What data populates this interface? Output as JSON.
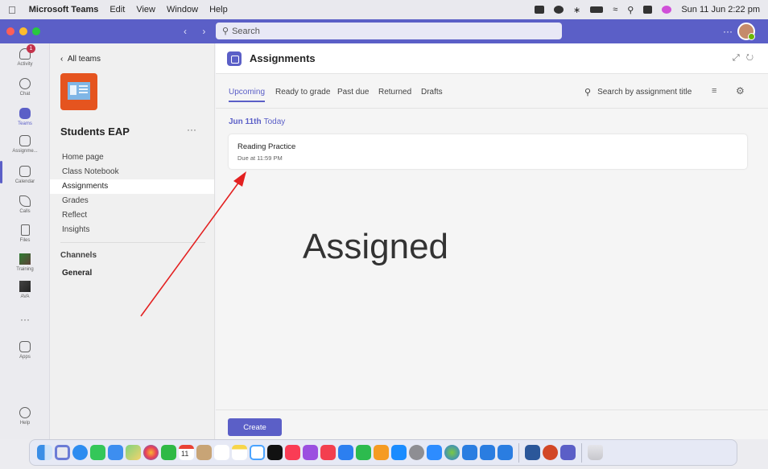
{
  "menubar": {
    "app_name": "Microsoft Teams",
    "items": [
      "Edit",
      "View",
      "Window",
      "Help"
    ],
    "datetime": "Sun 11 Jun  2:22 pm"
  },
  "titlebar": {
    "nav_arrows": "‹ ›",
    "search_placeholder": "Search",
    "more": "···"
  },
  "rail": {
    "items": [
      {
        "label": "Activity",
        "icon": "bell-icon",
        "badge": "1"
      },
      {
        "label": "Chat",
        "icon": "chat-icon"
      },
      {
        "label": "Teams",
        "icon": "teams-icon"
      },
      {
        "label": "Assignme...",
        "icon": "assignments-icon"
      },
      {
        "label": "Calendar",
        "icon": "calendar-icon"
      },
      {
        "label": "Calls",
        "icon": "phone-icon"
      },
      {
        "label": "Files",
        "icon": "file-icon"
      },
      {
        "label": "Training",
        "icon": "training-app-icon"
      },
      {
        "label": "AVA",
        "icon": "ava-app-icon"
      },
      {
        "label": "···",
        "icon": "more-icon"
      },
      {
        "label": "Apps",
        "icon": "apps-icon"
      },
      {
        "label": "Help",
        "icon": "help-icon"
      }
    ]
  },
  "team": {
    "back_label": "All teams",
    "name": "Students EAP",
    "more": "···",
    "nav": [
      "Home page",
      "Class Notebook",
      "Assignments",
      "Grades",
      "Reflect",
      "Insights"
    ],
    "channels_heading": "Channels",
    "channels": [
      "General"
    ]
  },
  "main": {
    "title": "Assignments",
    "tabs": [
      "Upcoming",
      "Ready to grade",
      "Past due",
      "Returned",
      "Drafts"
    ],
    "search_placeholder": "Search by assignment title",
    "date": "Jun 11th",
    "date_relative": "Today",
    "assignment": {
      "title": "Reading Practice",
      "due": "Due at 11:59 PM"
    },
    "annotation": "Assigned",
    "create_label": "Create"
  },
  "colors": {
    "brand": "#5b5fc7",
    "annotation_arrow": "#e32020",
    "badge": "#c4314b"
  },
  "dock": {
    "calendar_day": "11",
    "icons": [
      "finder-icon",
      "launchpad-icon",
      "safari-icon",
      "messages-icon",
      "mail-icon",
      "maps-icon",
      "photos-icon",
      "facetime-icon",
      "calendar-icon",
      "contacts-icon",
      "reminders-icon",
      "notes-icon",
      "freeform-icon",
      "tv-icon",
      "music-icon",
      "podcasts-icon",
      "news-icon",
      "keynote-icon",
      "numbers-icon",
      "pages-icon",
      "app-store-icon",
      "system-settings-icon",
      "zoom-icon",
      "finder-2-icon",
      "screen-share-icon",
      "screen-share-2-icon",
      "presentation-icon",
      "word-icon",
      "powerpoint-icon",
      "teams-dock-icon",
      "trash-icon"
    ]
  }
}
